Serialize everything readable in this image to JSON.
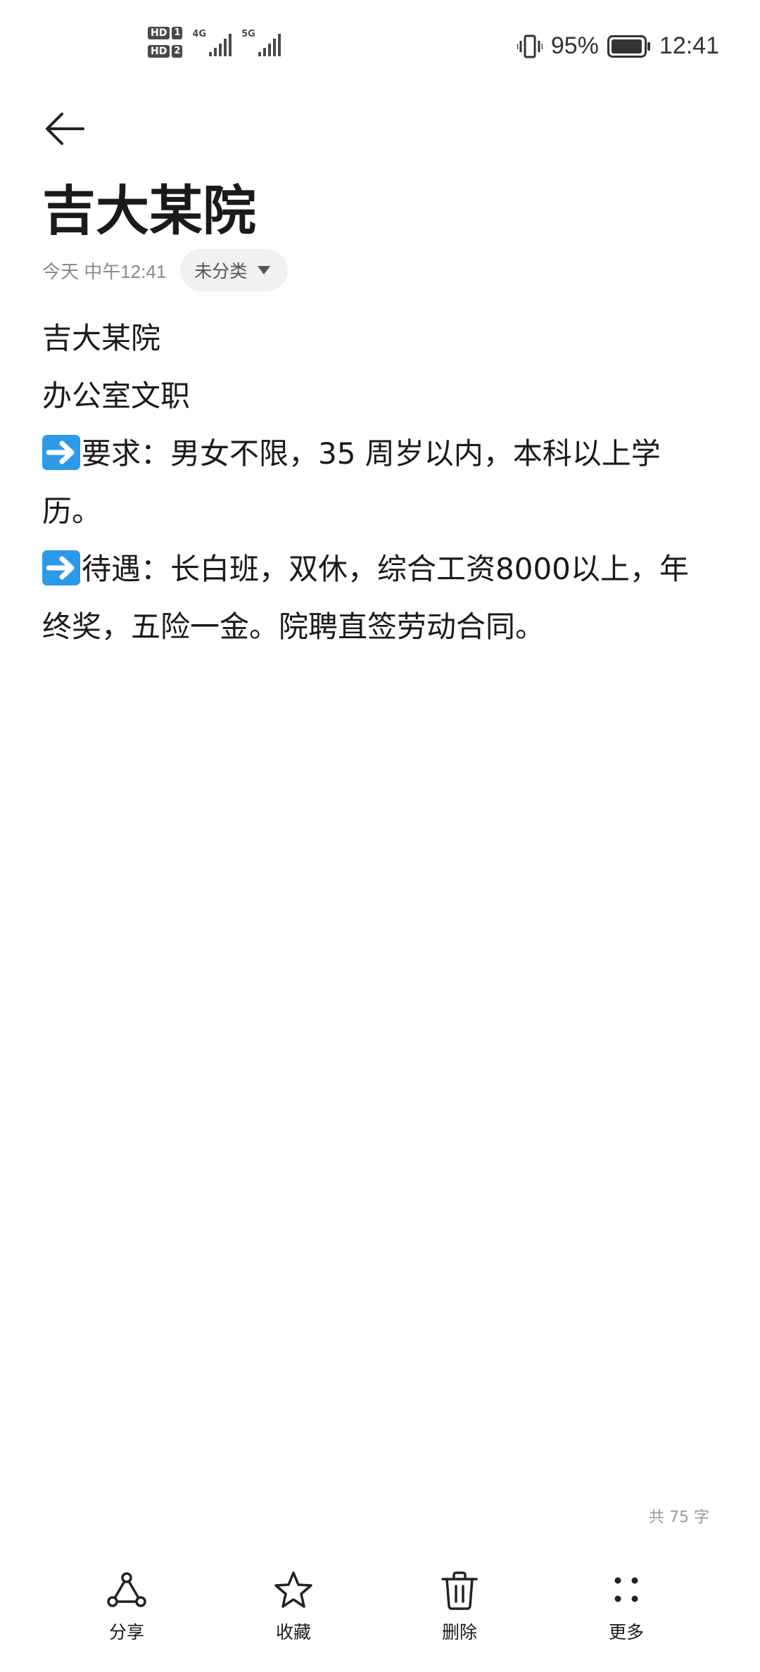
{
  "status_bar": {
    "sim1_badge": "HD",
    "sim1_number": "1",
    "sim2_badge": "HD",
    "sim2_number": "2",
    "sim1_network": "4G",
    "sim2_network": "5G",
    "battery_percent": "95%",
    "time": "12:41",
    "icons": [
      "vibrate-icon",
      "battery-icon"
    ]
  },
  "header": {
    "back_icon": "back-arrow-icon",
    "title": "吉大某院",
    "timestamp": "今天 中午12:41",
    "category": "未分类",
    "category_icon": "dropdown-triangle-icon"
  },
  "body": {
    "lines": [
      "吉大某院",
      "办公室文职",
      "要求：男女不限，35 周岁以内，本科以上学历。",
      "待遇：长白班，双休，综合工资8000以上，年终奖，五险一金。院聘直签劳动合同。"
    ],
    "bullet_icon": "right-arrow-emoji-icon",
    "bullet_color": "#2d9ae8"
  },
  "word_count": "共 75 字",
  "toolbar": {
    "items": [
      {
        "label": "分享",
        "icon": "share-icon"
      },
      {
        "label": "收藏",
        "icon": "star-icon"
      },
      {
        "label": "删除",
        "icon": "trash-icon"
      },
      {
        "label": "更多",
        "icon": "more-dots-icon"
      }
    ]
  }
}
